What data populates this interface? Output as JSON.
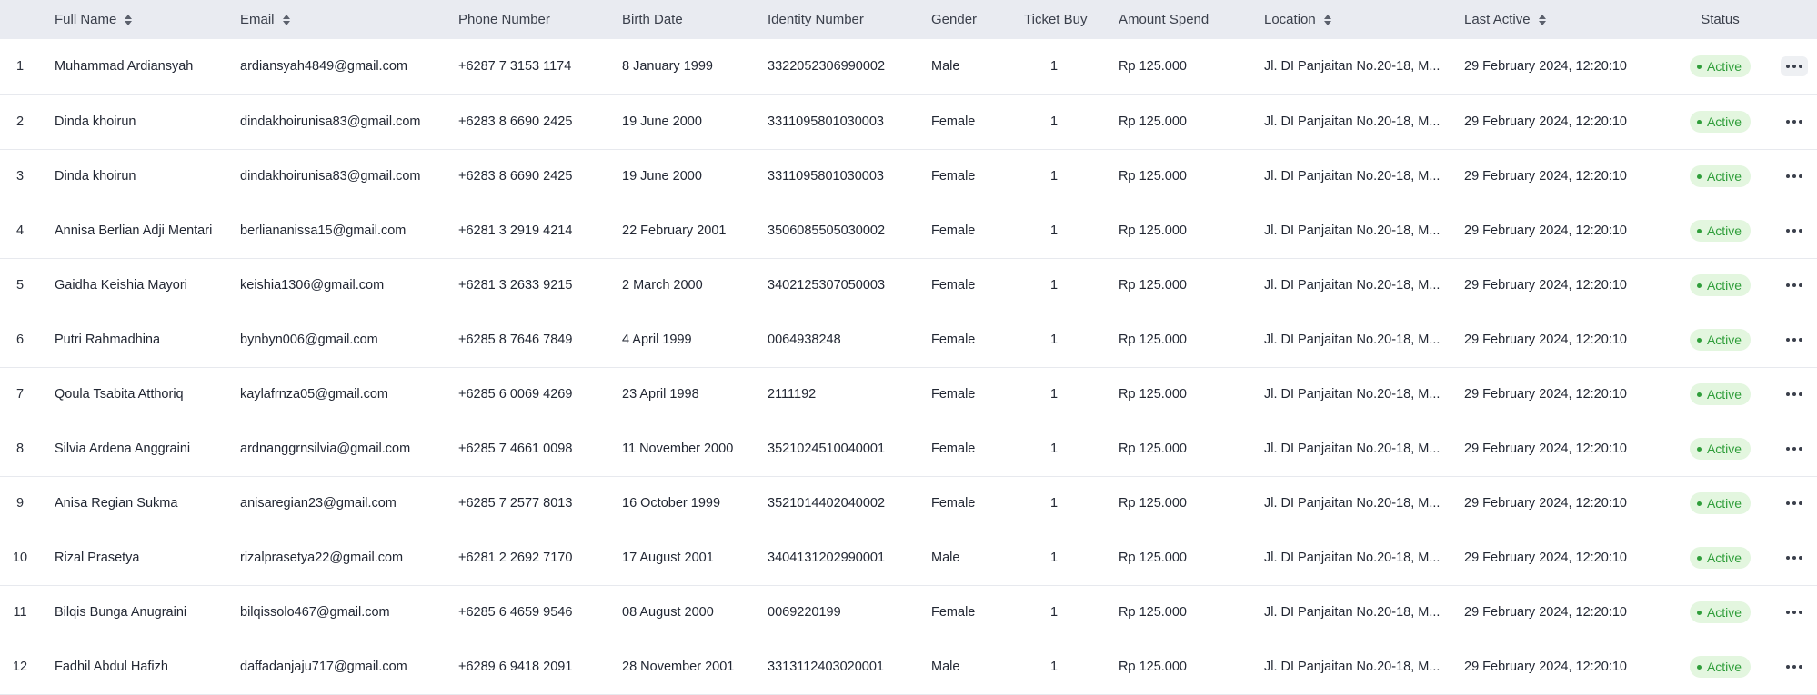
{
  "columns": {
    "no": "",
    "full_name": "Full Name",
    "email": "Email",
    "phone": "Phone Number",
    "birth_date": "Birth Date",
    "identity": "Identity Number",
    "gender": "Gender",
    "ticket_buy": "Ticket Buy",
    "amount_spend": "Amount Spend",
    "location": "Location",
    "last_active": "Last Active",
    "status": "Status"
  },
  "sortable_icon": "sort-icon",
  "status_color": "#2f9e3a",
  "status_bg": "#e3f6df",
  "rows": [
    {
      "no": "1",
      "full_name": "Muhammad Ardiansyah",
      "email": "ardiansyah4849@gmail.com",
      "phone": "+6287 7 3153 1174",
      "birth_date": "8 January 1999",
      "identity": "3322052306990002",
      "gender": "Male",
      "ticket_buy": "1",
      "amount_spend": "Rp 125.000",
      "location": "Jl. DI Panjaitan No.20-18, M...",
      "last_active": "29 February 2024, 12:20:10",
      "status": "Active"
    },
    {
      "no": "2",
      "full_name": "Dinda khoirun",
      "email": "dindakhoirunisa83@gmail.com",
      "phone": "+6283 8 6690 2425",
      "birth_date": "19 June 2000",
      "identity": "3311095801030003",
      "gender": "Female",
      "ticket_buy": "1",
      "amount_spend": "Rp 125.000",
      "location": "Jl. DI Panjaitan No.20-18, M...",
      "last_active": "29 February 2024, 12:20:10",
      "status": "Active"
    },
    {
      "no": "3",
      "full_name": "Dinda khoirun",
      "email": "dindakhoirunisa83@gmail.com",
      "phone": "+6283 8 6690 2425",
      "birth_date": "19 June 2000",
      "identity": "3311095801030003",
      "gender": "Female",
      "ticket_buy": "1",
      "amount_spend": "Rp 125.000",
      "location": "Jl. DI Panjaitan No.20-18, M...",
      "last_active": "29 February 2024, 12:20:10",
      "status": "Active"
    },
    {
      "no": "4",
      "full_name": "Annisa Berlian Adji Mentari",
      "email": "berliananissa15@gmail.com",
      "phone": "+6281 3 2919 4214",
      "birth_date": "22 February 2001",
      "identity": "3506085505030002",
      "gender": "Female",
      "ticket_buy": "1",
      "amount_spend": "Rp 125.000",
      "location": "Jl. DI Panjaitan No.20-18, M...",
      "last_active": "29 February 2024, 12:20:10",
      "status": "Active"
    },
    {
      "no": "5",
      "full_name": "Gaidha Keishia Mayori",
      "email": "keishia1306@gmail.com",
      "phone": "+6281 3 2633 9215",
      "birth_date": "2 March 2000",
      "identity": "3402125307050003",
      "gender": "Female",
      "ticket_buy": "1",
      "amount_spend": "Rp 125.000",
      "location": "Jl. DI Panjaitan No.20-18, M...",
      "last_active": "29 February 2024, 12:20:10",
      "status": "Active"
    },
    {
      "no": "6",
      "full_name": "Putri Rahmadhina",
      "email": "bynbyn006@gmail.com",
      "phone": "+6285 8 7646 7849",
      "birth_date": "4 April 1999",
      "identity": "0064938248",
      "gender": "Female",
      "ticket_buy": "1",
      "amount_spend": "Rp 125.000",
      "location": "Jl. DI Panjaitan No.20-18, M...",
      "last_active": "29 February 2024, 12:20:10",
      "status": "Active"
    },
    {
      "no": "7",
      "full_name": "Qoula Tsabita Atthoriq",
      "email": "kaylafrnza05@gmail.com",
      "phone": "+6285 6 0069 4269",
      "birth_date": "23 April 1998",
      "identity": "2111192",
      "gender": "Female",
      "ticket_buy": "1",
      "amount_spend": "Rp 125.000",
      "location": "Jl. DI Panjaitan No.20-18, M...",
      "last_active": "29 February 2024, 12:20:10",
      "status": "Active"
    },
    {
      "no": "8",
      "full_name": "Silvia Ardena Anggraini",
      "email": "ardnanggrnsilvia@gmail.com",
      "phone": "+6285 7 4661 0098",
      "birth_date": "11 November 2000",
      "identity": "3521024510040001",
      "gender": "Female",
      "ticket_buy": "1",
      "amount_spend": "Rp 125.000",
      "location": "Jl. DI Panjaitan No.20-18, M...",
      "last_active": "29 February 2024, 12:20:10",
      "status": "Active"
    },
    {
      "no": "9",
      "full_name": "Anisa Regian Sukma",
      "email": "anisaregian23@gmail.com",
      "phone": "+6285 7 2577 8013",
      "birth_date": "16 October 1999",
      "identity": "3521014402040002",
      "gender": "Female",
      "ticket_buy": "1",
      "amount_spend": "Rp 125.000",
      "location": "Jl. DI Panjaitan No.20-18, M...",
      "last_active": "29 February 2024, 12:20:10",
      "status": "Active"
    },
    {
      "no": "10",
      "full_name": "Rizal Prasetya",
      "email": "rizalprasetya22@gmail.com",
      "phone": "+6281 2 2692 7170",
      "birth_date": "17 August 2001",
      "identity": "3404131202990001",
      "gender": "Male",
      "ticket_buy": "1",
      "amount_spend": "Rp 125.000",
      "location": "Jl. DI Panjaitan No.20-18, M...",
      "last_active": "29 February 2024, 12:20:10",
      "status": "Active"
    },
    {
      "no": "11",
      "full_name": "Bilqis Bunga Anugraini",
      "email": "bilqissolo467@gmail.com",
      "phone": "+6285 6 4659 9546",
      "birth_date": "08 August 2000",
      "identity": "0069220199",
      "gender": "Female",
      "ticket_buy": "1",
      "amount_spend": "Rp 125.000",
      "location": "Jl. DI Panjaitan No.20-18, M...",
      "last_active": "29 February 2024, 12:20:10",
      "status": "Active"
    },
    {
      "no": "12",
      "full_name": "Fadhil Abdul Hafizh",
      "email": "daffadanjaju717@gmail.com",
      "phone": "+6289 6 9418 2091",
      "birth_date": "28 November 2001",
      "identity": "3313112403020001",
      "gender": "Male",
      "ticket_buy": "1",
      "amount_spend": "Rp 125.000",
      "location": "Jl. DI Panjaitan No.20-18, M...",
      "last_active": "29 February 2024, 12:20:10",
      "status": "Active"
    }
  ]
}
